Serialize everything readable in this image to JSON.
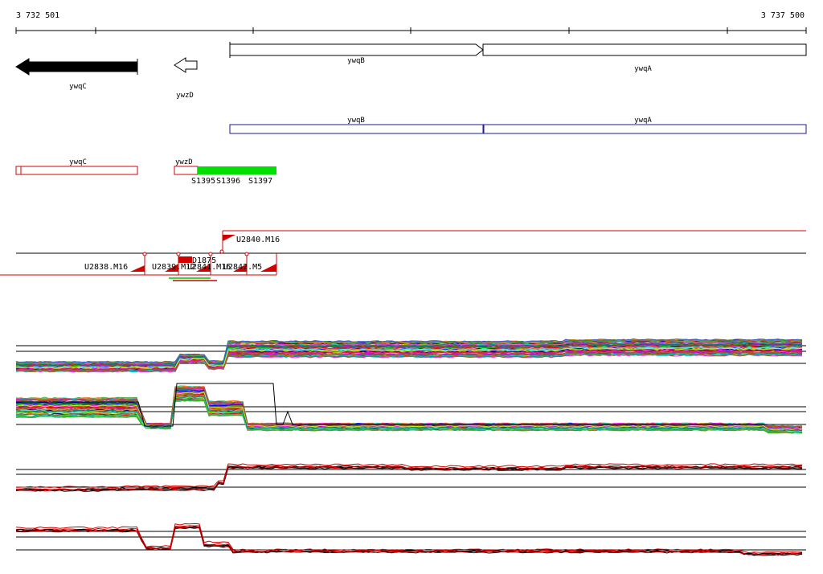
{
  "coords": {
    "start": "3 732 501",
    "end": "3 737 500"
  },
  "genes": [
    {
      "name": "ywqC",
      "strand": "-",
      "style": "filled"
    },
    {
      "name": "ywzD",
      "strand": "-",
      "style": "outline"
    },
    {
      "name": "ywqB",
      "strand": "+",
      "style": "outline"
    },
    {
      "name": "ywqA",
      "strand": "+",
      "style": "outline"
    }
  ],
  "blue_track": [
    "ywqB",
    "ywqA"
  ],
  "red_track": [
    "ywqC",
    "ywzD"
  ],
  "sites": [
    "S1395",
    "S1396",
    "S1397"
  ],
  "segments": {
    "upper": "U2840.M16",
    "lower": [
      "U2838.M16",
      "U2839.M12",
      "U2841.M16",
      "U2842.M5"
    ],
    "down": "D1875"
  },
  "colors": {
    "gene_fill": "#000000",
    "blue_track": "#1a1aa6",
    "red_track": "#d40000",
    "site_fill": "#00e000",
    "axis": "#000000"
  }
}
